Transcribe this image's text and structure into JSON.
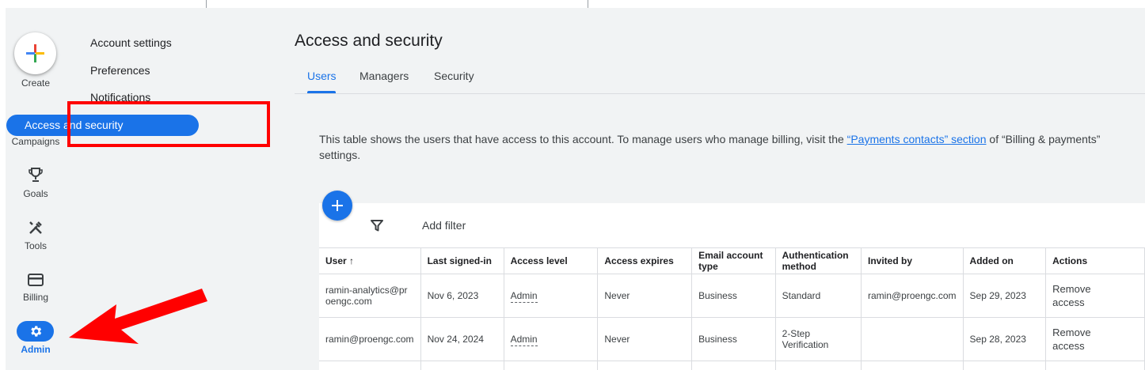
{
  "create": {
    "label": "Create"
  },
  "rail": {
    "items": [
      {
        "label": "Campaigns",
        "icon": "megaphone-icon"
      },
      {
        "label": "Goals",
        "icon": "trophy-icon"
      },
      {
        "label": "Tools",
        "icon": "tools-icon"
      },
      {
        "label": "Billing",
        "icon": "credit-card-icon"
      },
      {
        "label": "Admin",
        "icon": "gear-icon"
      }
    ]
  },
  "subnav": {
    "items": [
      {
        "label": "Account settings"
      },
      {
        "label": "Preferences"
      },
      {
        "label": "Notifications"
      },
      {
        "label": "Access and security"
      }
    ]
  },
  "page": {
    "title": "Access and security",
    "tabs": [
      {
        "label": "Users"
      },
      {
        "label": "Managers"
      },
      {
        "label": "Security"
      }
    ],
    "active_tab": "Users",
    "description_before": "This table shows the users that have access to this account. To manage users who manage billing, visit the ",
    "description_link": "“Payments contacts” section",
    "description_after": " of “Billing & payments” settings."
  },
  "filter": {
    "label": "Add filter"
  },
  "table": {
    "headers": [
      "User",
      "Last signed-in",
      "Access level",
      "Access expires",
      "Email account type",
      "Authentication method",
      "Invited by",
      "Added on",
      "Actions"
    ],
    "rows": [
      {
        "user": "ramin-analytics@proengc.com",
        "last_signed_in": "Nov 6, 2023",
        "access_level": "Admin",
        "access_expires": "Never",
        "email_type": "Business",
        "auth_method": "Standard",
        "invited_by": "ramin@proengc.com",
        "added_on": "Sep 29, 2023",
        "action": "Remove access"
      },
      {
        "user": "ramin@proengc.com",
        "last_signed_in": "Nov 24, 2024",
        "access_level": "Admin",
        "access_expires": "Never",
        "email_type": "Business",
        "auth_method": "2-Step Verification",
        "invited_by": "",
        "added_on": "Sep 28, 2023",
        "action": "Remove access"
      }
    ]
  },
  "colors": {
    "accent": "#1a73e8",
    "highlight": "#ff0000",
    "background": "#f1f3f4"
  }
}
